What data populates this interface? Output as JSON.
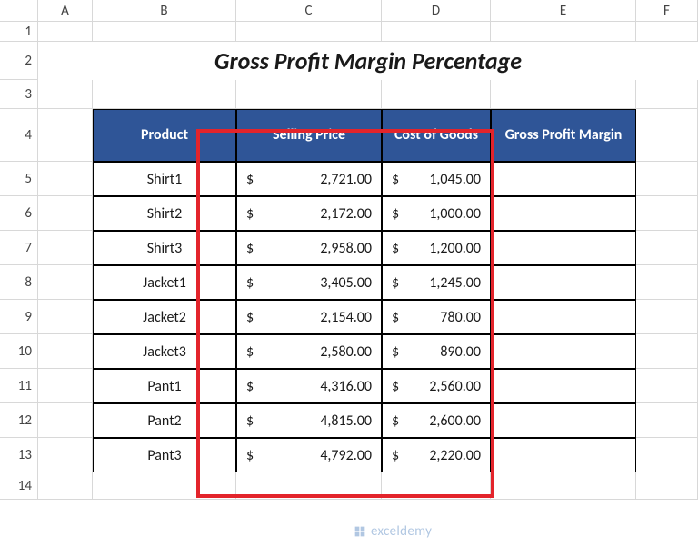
{
  "columns": [
    "A",
    "B",
    "C",
    "D",
    "E",
    "F"
  ],
  "rows": [
    "1",
    "2",
    "3",
    "4",
    "5",
    "6",
    "7",
    "8",
    "9",
    "10",
    "11",
    "12",
    "13",
    "14"
  ],
  "title": "Gross Profit Margin Percentage",
  "headers": {
    "product": "Product",
    "selling": "Selling Price",
    "cost": "Cost of Goods",
    "margin": "Gross Profit Margin"
  },
  "table": [
    {
      "product": "Shirt1",
      "selling": "2,721.00",
      "cost": "1,045.00"
    },
    {
      "product": "Shirt2",
      "selling": "2,172.00",
      "cost": "1,000.00"
    },
    {
      "product": "Shirt3",
      "selling": "2,958.00",
      "cost": "1,200.00"
    },
    {
      "product": "Jacket1",
      "selling": "3,405.00",
      "cost": "1,245.00"
    },
    {
      "product": "Jacket2",
      "selling": "2,154.00",
      "cost": "780.00"
    },
    {
      "product": "Jacket3",
      "selling": "2,580.00",
      "cost": "890.00"
    },
    {
      "product": "Pant1",
      "selling": "4,316.00",
      "cost": "2,560.00"
    },
    {
      "product": "Pant2",
      "selling": "4,815.00",
      "cost": "2,600.00"
    },
    {
      "product": "Pant3",
      "selling": "4,792.00",
      "cost": "2,220.00"
    }
  ],
  "currency": "$",
  "watermark": "exceldemy"
}
